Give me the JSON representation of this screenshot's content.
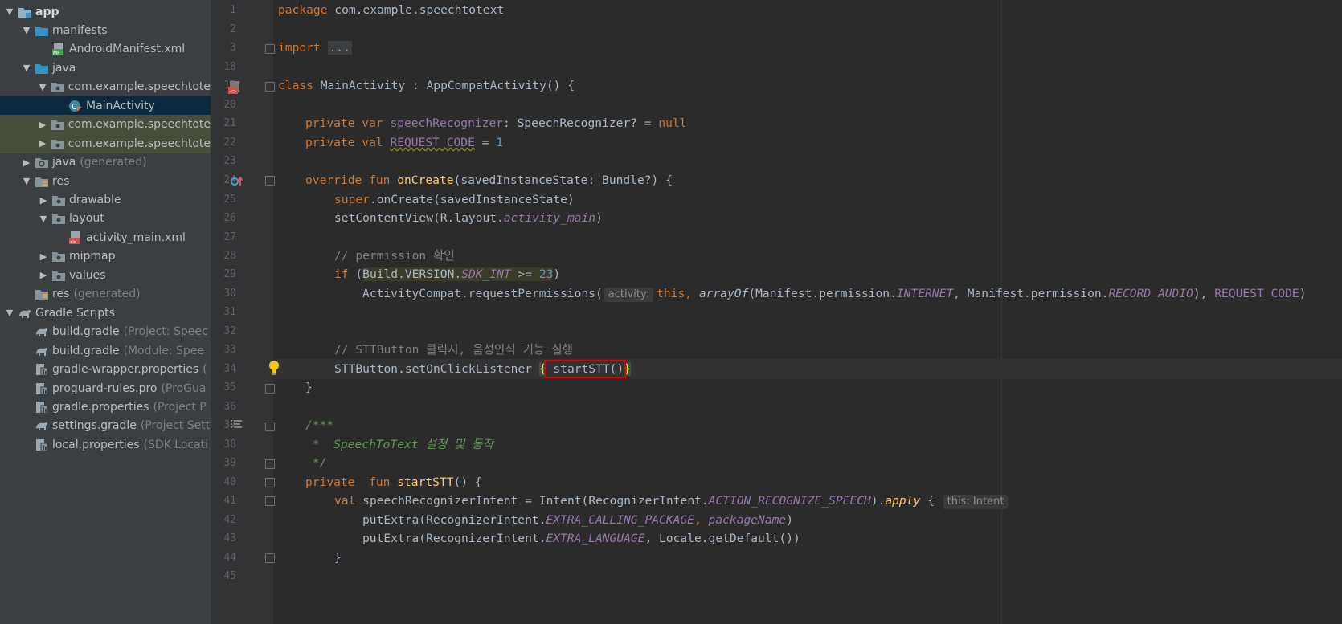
{
  "tree": {
    "items": [
      {
        "label": "app",
        "suffix": "",
        "depth": 0,
        "arrow": "down",
        "icon": "module-folder-icon",
        "bold": true
      },
      {
        "label": "manifests",
        "suffix": "",
        "depth": 1,
        "arrow": "down",
        "icon": "folder-icon"
      },
      {
        "label": "AndroidManifest.xml",
        "suffix": "",
        "depth": 2,
        "arrow": "",
        "icon": "manifest-file-icon"
      },
      {
        "label": "java",
        "suffix": "",
        "depth": 1,
        "arrow": "down",
        "icon": "folder-icon"
      },
      {
        "label": "com.example.speechtote",
        "suffix": "",
        "depth": 2,
        "arrow": "down",
        "icon": "package-icon"
      },
      {
        "label": "MainActivity",
        "suffix": "",
        "depth": 3,
        "arrow": "",
        "icon": "kotlin-class-icon",
        "selected": true
      },
      {
        "label": "com.example.speechtote",
        "suffix": "",
        "depth": 2,
        "arrow": "right",
        "icon": "package-icon",
        "tint": "green"
      },
      {
        "label": "com.example.speechtote",
        "suffix": "",
        "depth": 2,
        "arrow": "right",
        "icon": "package-icon",
        "tint": "green"
      },
      {
        "label": "java",
        "suffix": "(generated)",
        "depth": 1,
        "arrow": "right",
        "icon": "generated-folder-icon"
      },
      {
        "label": "res",
        "suffix": "",
        "depth": 1,
        "arrow": "down",
        "icon": "res-folder-icon"
      },
      {
        "label": "drawable",
        "suffix": "",
        "depth": 2,
        "arrow": "right",
        "icon": "package-icon"
      },
      {
        "label": "layout",
        "suffix": "",
        "depth": 2,
        "arrow": "down",
        "icon": "package-icon"
      },
      {
        "label": "activity_main.xml",
        "suffix": "",
        "depth": 3,
        "arrow": "",
        "icon": "layout-file-icon"
      },
      {
        "label": "mipmap",
        "suffix": "",
        "depth": 2,
        "arrow": "right",
        "icon": "package-icon"
      },
      {
        "label": "values",
        "suffix": "",
        "depth": 2,
        "arrow": "right",
        "icon": "package-icon"
      },
      {
        "label": "res",
        "suffix": "(generated)",
        "depth": 1,
        "arrow": "",
        "icon": "res-folder-icon"
      },
      {
        "label": "Gradle Scripts",
        "suffix": "",
        "depth": 0,
        "arrow": "down",
        "icon": "gradle-icon"
      },
      {
        "label": "build.gradle",
        "suffix": "(Project: Speec",
        "depth": 1,
        "arrow": "",
        "icon": "gradle-icon"
      },
      {
        "label": "build.gradle",
        "suffix": "(Module: Spee",
        "depth": 1,
        "arrow": "",
        "icon": "gradle-icon"
      },
      {
        "label": "gradle-wrapper.properties",
        "suffix": "(",
        "depth": 1,
        "arrow": "",
        "icon": "properties-icon"
      },
      {
        "label": "proguard-rules.pro",
        "suffix": "(ProGua",
        "depth": 1,
        "arrow": "",
        "icon": "properties-icon"
      },
      {
        "label": "gradle.properties",
        "suffix": "(Project P",
        "depth": 1,
        "arrow": "",
        "icon": "properties-icon"
      },
      {
        "label": "settings.gradle",
        "suffix": "(Project Sett",
        "depth": 1,
        "arrow": "",
        "icon": "gradle-icon"
      },
      {
        "label": "local.properties",
        "suffix": "(SDK Locati",
        "depth": 1,
        "arrow": "",
        "icon": "properties-icon"
      }
    ]
  },
  "editor": {
    "line_numbers": [
      "1",
      "2",
      "3",
      "18",
      "19",
      "20",
      "21",
      "22",
      "23",
      "24",
      "25",
      "26",
      "27",
      "28",
      "29",
      "30",
      "31",
      "32",
      "33",
      "34",
      "35",
      "36",
      "37",
      "38",
      "39",
      "40",
      "41",
      "42",
      "43",
      "44",
      "45"
    ],
    "tokens": {
      "l1a": "package",
      "l1b": " com.example.speechtotext",
      "l3a": "import",
      "l3b": "...",
      "l19a": "class",
      "l19b": " MainActivity : AppCompatActivity() {",
      "l21a": "private var ",
      "l21b": "speechRecognizer",
      "l21c": ": SpeechRecognizer? = ",
      "l21d": "null",
      "l22a": "private val ",
      "l22b": "REQUEST_CODE",
      "l22c": " = ",
      "l22d": "1",
      "l24a": "override fun ",
      "l24b": "onCreate",
      "l24c": "(savedInstanceState: Bundle?) {",
      "l25a": "super",
      "l25b": ".onCreate(savedInstanceState)",
      "l26a": "setContentView(R.layout.",
      "l26b": "activity_main",
      "l26c": ")",
      "l28": "// permission 확인",
      "l29a": "if ",
      "l29b": "(",
      "l29c": "Build.VERSION.",
      "l29d": "SDK_INT",
      "l29e": " >= ",
      "l29f": "23",
      "l29g": ")",
      "l30a": "ActivityCompat.requestPermissions(",
      "l30hint": "activity:",
      "l30b": "this",
      "l30c": ", ",
      "l30d": "arrayOf",
      "l30e": "(Manifest.permission.",
      "l30f": "INTERNET",
      "l30g": ", Manifest.permission.",
      "l30h": "RECORD_AUDIO",
      "l30i": "), ",
      "l30j": "REQUEST_CODE",
      "l30k": ")",
      "l33": "// STTButton 클릭시, 음성인식 기능 실행",
      "l34a": "STTButton.setOnClickListener ",
      "l34b": "{",
      "l34c": " startSTT()",
      "l34d": "}",
      "l35": "}",
      "l37": "/***",
      "l38": " *  SpeechToText 설정 및 동작",
      "l39": " */",
      "l40a": "private  fun ",
      "l40b": "startSTT",
      "l40c": "() {",
      "l41a": "val ",
      "l41b": "speechRecognizerIntent = Intent(RecognizerIntent.",
      "l41c": "ACTION_RECOGNIZE_SPEECH",
      "l41d": ").",
      "l41e": "apply",
      "l41f": " {",
      "l41hint": "this: Intent",
      "l42a": "putExtra(RecognizerIntent.",
      "l42b": "EXTRA_CALLING_PACKAGE",
      "l42c": ", ",
      "l42d": "packageName",
      "l42e": ")",
      "l43a": "putExtra(RecognizerIntent.",
      "l43b": "EXTRA_LANGUAGE",
      "l43c": ", Locale.getDefault())",
      "l44": "}"
    }
  },
  "colors": {
    "keyword": "#cc7832",
    "function": "#ffc66d",
    "number": "#6897bb",
    "property": "#9876aa",
    "comment": "#808080",
    "doc": "#629755",
    "selection": "#0d293e"
  }
}
